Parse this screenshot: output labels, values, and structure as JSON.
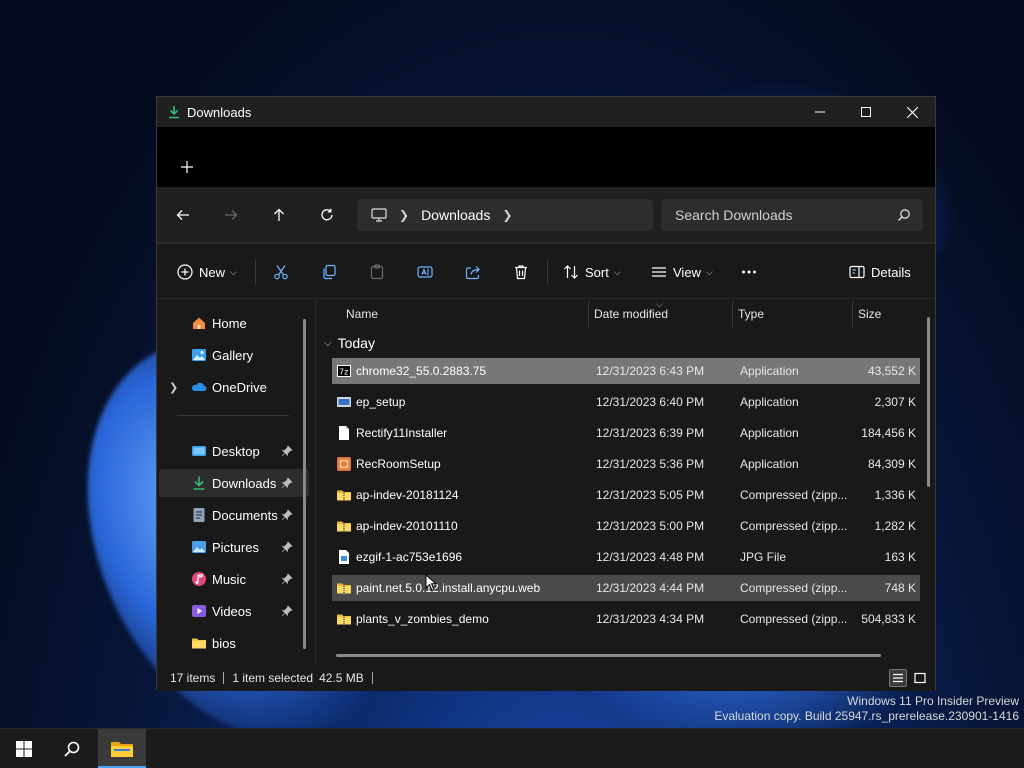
{
  "window": {
    "title": "Downloads"
  },
  "navbar": {
    "breadcrumb": "Downloads",
    "search_placeholder": "Search Downloads"
  },
  "toolbar": {
    "new_label": "New",
    "sort_label": "Sort",
    "view_label": "View",
    "details_label": "Details"
  },
  "sidebar": {
    "items": [
      {
        "label": "Home",
        "icon": "home-icon"
      },
      {
        "label": "Gallery",
        "icon": "gallery-icon"
      },
      {
        "label": "OneDrive",
        "icon": "onedrive-icon"
      },
      {
        "label": "Desktop",
        "icon": "desktop-icon"
      },
      {
        "label": "Downloads",
        "icon": "downloads-icon"
      },
      {
        "label": "Documents",
        "icon": "documents-icon"
      },
      {
        "label": "Pictures",
        "icon": "pictures-icon"
      },
      {
        "label": "Music",
        "icon": "music-icon"
      },
      {
        "label": "Videos",
        "icon": "videos-icon"
      },
      {
        "label": "bios",
        "icon": "folder-icon"
      }
    ]
  },
  "columns": {
    "name": "Name",
    "date": "Date modified",
    "type": "Type",
    "size": "Size"
  },
  "group_label": "Today",
  "files": [
    {
      "name": "chrome32_55.0.2883.75",
      "date": "12/31/2023 6:43 PM",
      "type": "Application",
      "size": "43,552 K"
    },
    {
      "name": "ep_setup",
      "date": "12/31/2023 6:40 PM",
      "type": "Application",
      "size": "2,307 K"
    },
    {
      "name": "Rectify11Installer",
      "date": "12/31/2023 6:39 PM",
      "type": "Application",
      "size": "184,456 K"
    },
    {
      "name": "RecRoomSetup",
      "date": "12/31/2023 5:36 PM",
      "type": "Application",
      "size": "84,309 K"
    },
    {
      "name": "ap-indev-20181124",
      "date": "12/31/2023 5:05 PM",
      "type": "Compressed (zipp...",
      "size": "1,336 K"
    },
    {
      "name": "ap-indev-20101110",
      "date": "12/31/2023 5:00 PM",
      "type": "Compressed (zipp...",
      "size": "1,282 K"
    },
    {
      "name": "ezgif-1-ac753e1696",
      "date": "12/31/2023 4:48 PM",
      "type": "JPG File",
      "size": "163 K"
    },
    {
      "name": "paint.net.5.0.12.install.anycpu.web",
      "date": "12/31/2023 4:44 PM",
      "type": "Compressed (zipp...",
      "size": "748 K"
    },
    {
      "name": "plants_v_zombies_demo",
      "date": "12/31/2023 4:34 PM",
      "type": "Compressed (zipp...",
      "size": "504,833 K"
    }
  ],
  "status": {
    "items": "17 items",
    "selected": "1 item selected",
    "size": "42.5 MB"
  },
  "watermark": {
    "line1": "Windows 11 Pro Insider Preview",
    "line2": "Evaluation copy. Build 25947.rs_prerelease.230901-1416"
  },
  "colors": {
    "accent": "#4aa3ff",
    "window_bg": "#191919",
    "selected_row": "#777777"
  }
}
